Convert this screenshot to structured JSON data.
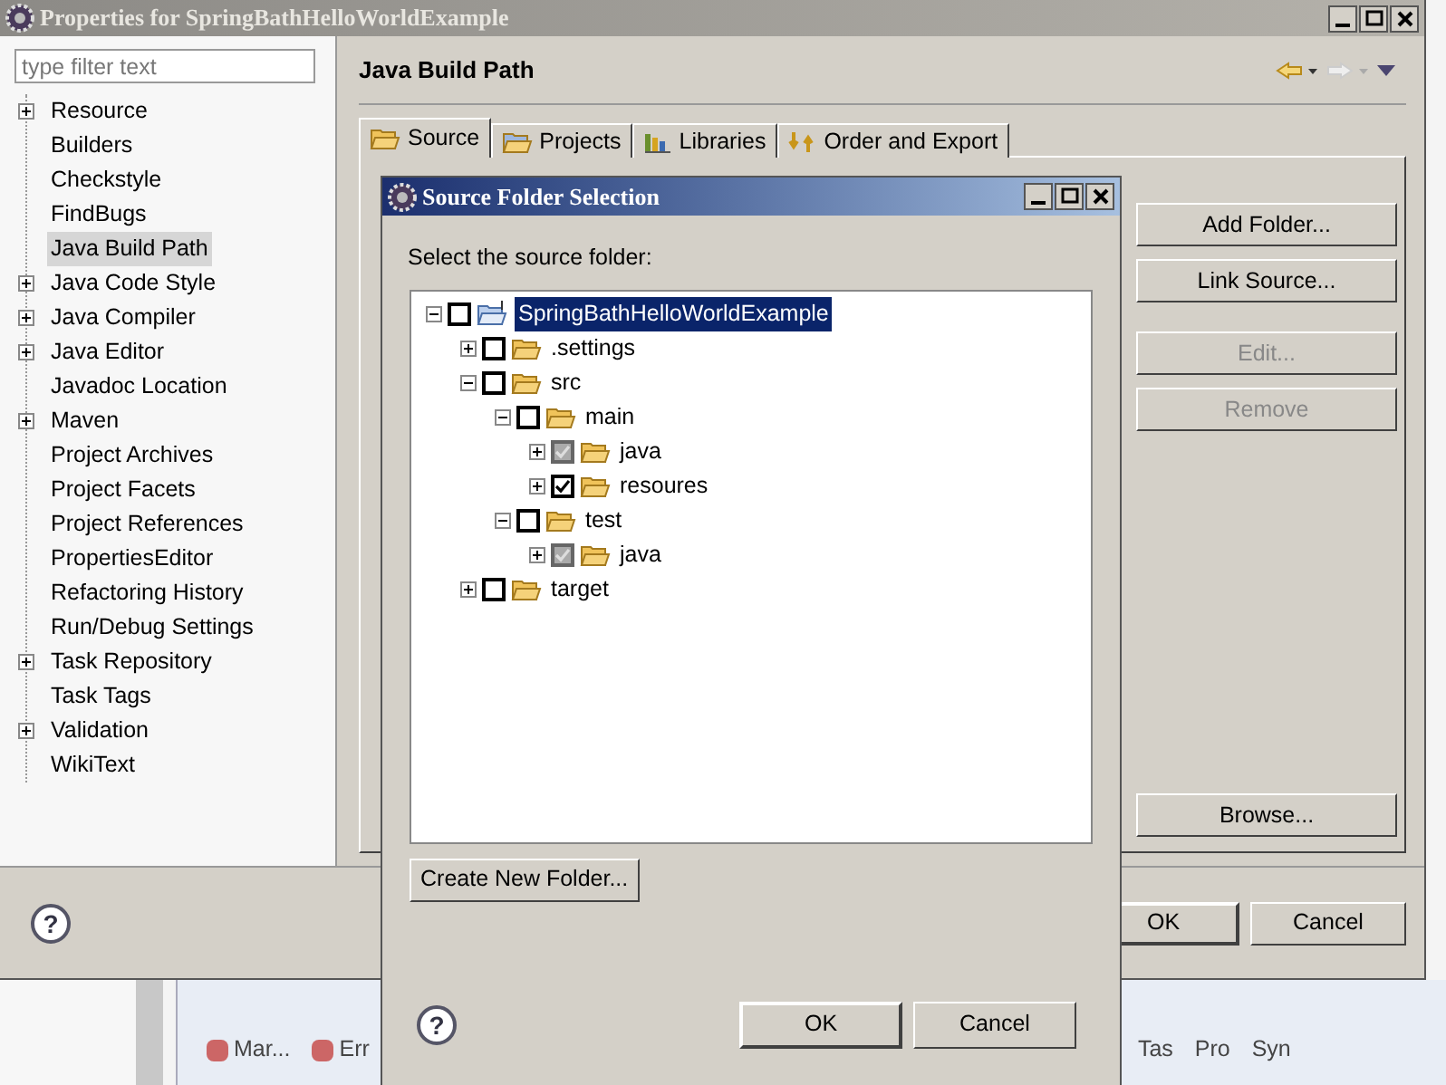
{
  "window": {
    "title": "Properties for SpringBathHelloWorldExample"
  },
  "filter": {
    "placeholder": "type filter text"
  },
  "sidebar": {
    "items": [
      {
        "label": "Resource",
        "kind": "branch",
        "selected": false
      },
      {
        "label": "Builders",
        "kind": "leaf",
        "selected": false
      },
      {
        "label": "Checkstyle",
        "kind": "leaf",
        "selected": false
      },
      {
        "label": "FindBugs",
        "kind": "leaf",
        "selected": false
      },
      {
        "label": "Java Build Path",
        "kind": "leaf",
        "selected": true
      },
      {
        "label": "Java Code Style",
        "kind": "branch",
        "selected": false
      },
      {
        "label": "Java Compiler",
        "kind": "branch",
        "selected": false
      },
      {
        "label": "Java Editor",
        "kind": "branch",
        "selected": false
      },
      {
        "label": "Javadoc Location",
        "kind": "leaf",
        "selected": false
      },
      {
        "label": "Maven",
        "kind": "branch",
        "selected": false
      },
      {
        "label": "Project Archives",
        "kind": "leaf",
        "selected": false
      },
      {
        "label": "Project Facets",
        "kind": "leaf",
        "selected": false
      },
      {
        "label": "Project References",
        "kind": "leaf",
        "selected": false
      },
      {
        "label": "PropertiesEditor",
        "kind": "leaf",
        "selected": false
      },
      {
        "label": "Refactoring History",
        "kind": "leaf",
        "selected": false
      },
      {
        "label": "Run/Debug Settings",
        "kind": "leaf",
        "selected": false
      },
      {
        "label": "Task Repository",
        "kind": "branch",
        "selected": false
      },
      {
        "label": "Task Tags",
        "kind": "leaf",
        "selected": false
      },
      {
        "label": "Validation",
        "kind": "branch",
        "selected": false
      },
      {
        "label": "WikiText",
        "kind": "leaf",
        "selected": false
      }
    ]
  },
  "page": {
    "title": "Java Build Path"
  },
  "tabs": [
    {
      "label": "Source",
      "selected": true
    },
    {
      "label": "Projects",
      "selected": false
    },
    {
      "label": "Libraries",
      "selected": false
    },
    {
      "label": "Order and Export",
      "selected": false
    }
  ],
  "side_buttons": [
    {
      "label": "Add Folder...",
      "disabled": false
    },
    {
      "label": "Link Source...",
      "disabled": false
    },
    {
      "label": "Edit...",
      "disabled": true
    },
    {
      "label": "Remove",
      "disabled": true
    }
  ],
  "browse_button": "Browse...",
  "help_glyph": "?",
  "footer_buttons": [
    "OK",
    "Cancel"
  ],
  "background_tabs": {
    "left": [
      "Mar...",
      "Err"
    ],
    "right": [
      "Tas",
      "Pro",
      "Syn"
    ]
  },
  "dialog": {
    "title": "Source Folder Selection",
    "prompt": "Select the source folder:",
    "tree": [
      {
        "label": "SpringBathHelloWorldExample",
        "kind": "project",
        "expanded": true,
        "checked": false,
        "grayed": false,
        "selected": true,
        "children": [
          {
            "label": ".settings",
            "kind": "folder",
            "expanded": false,
            "checked": false,
            "grayed": false,
            "selected": false
          },
          {
            "label": "src",
            "kind": "folder",
            "expanded": true,
            "checked": false,
            "grayed": false,
            "selected": false,
            "children": [
              {
                "label": "main",
                "kind": "folder",
                "expanded": true,
                "checked": false,
                "grayed": false,
                "selected": false,
                "children": [
                  {
                    "label": "java",
                    "kind": "folder",
                    "expanded": false,
                    "checked": true,
                    "grayed": true,
                    "selected": false
                  },
                  {
                    "label": "resoures",
                    "kind": "folder",
                    "expanded": false,
                    "checked": true,
                    "grayed": false,
                    "selected": false
                  }
                ]
              },
              {
                "label": "test",
                "kind": "folder",
                "expanded": true,
                "checked": false,
                "grayed": false,
                "selected": false,
                "children": [
                  {
                    "label": "java",
                    "kind": "folder",
                    "expanded": false,
                    "checked": true,
                    "grayed": true,
                    "selected": false
                  }
                ]
              }
            ]
          },
          {
            "label": "target",
            "kind": "folder",
            "expanded": false,
            "checked": false,
            "grayed": false,
            "selected": false
          }
        ]
      }
    ],
    "create_button": "Create New Folder...",
    "buttons": [
      "OK",
      "Cancel"
    ]
  }
}
